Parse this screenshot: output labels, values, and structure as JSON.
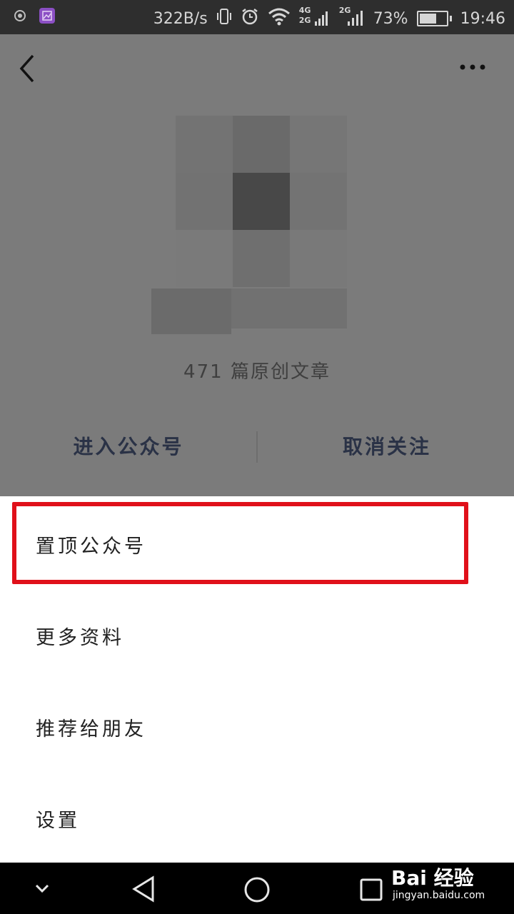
{
  "status_bar": {
    "network_speed": "322B/s",
    "signal_1_label_top": "4G",
    "signal_1_label_bottom": "2G",
    "signal_2_label": "2G",
    "battery_percent": "73%",
    "battery_level": 0.73,
    "time": "19:46"
  },
  "profile": {
    "article_count": "471 篇原创文章",
    "enter_button": "进入公众号",
    "unfollow_button": "取消关注"
  },
  "menu": {
    "items": [
      {
        "label": "置顶公众号"
      },
      {
        "label": "更多资料"
      },
      {
        "label": "推荐给朋友"
      },
      {
        "label": "设置"
      }
    ],
    "highlight_color": "#e0101a"
  },
  "watermark": {
    "brand": "Bai 经验",
    "url": "jingyan.baidu.com"
  }
}
